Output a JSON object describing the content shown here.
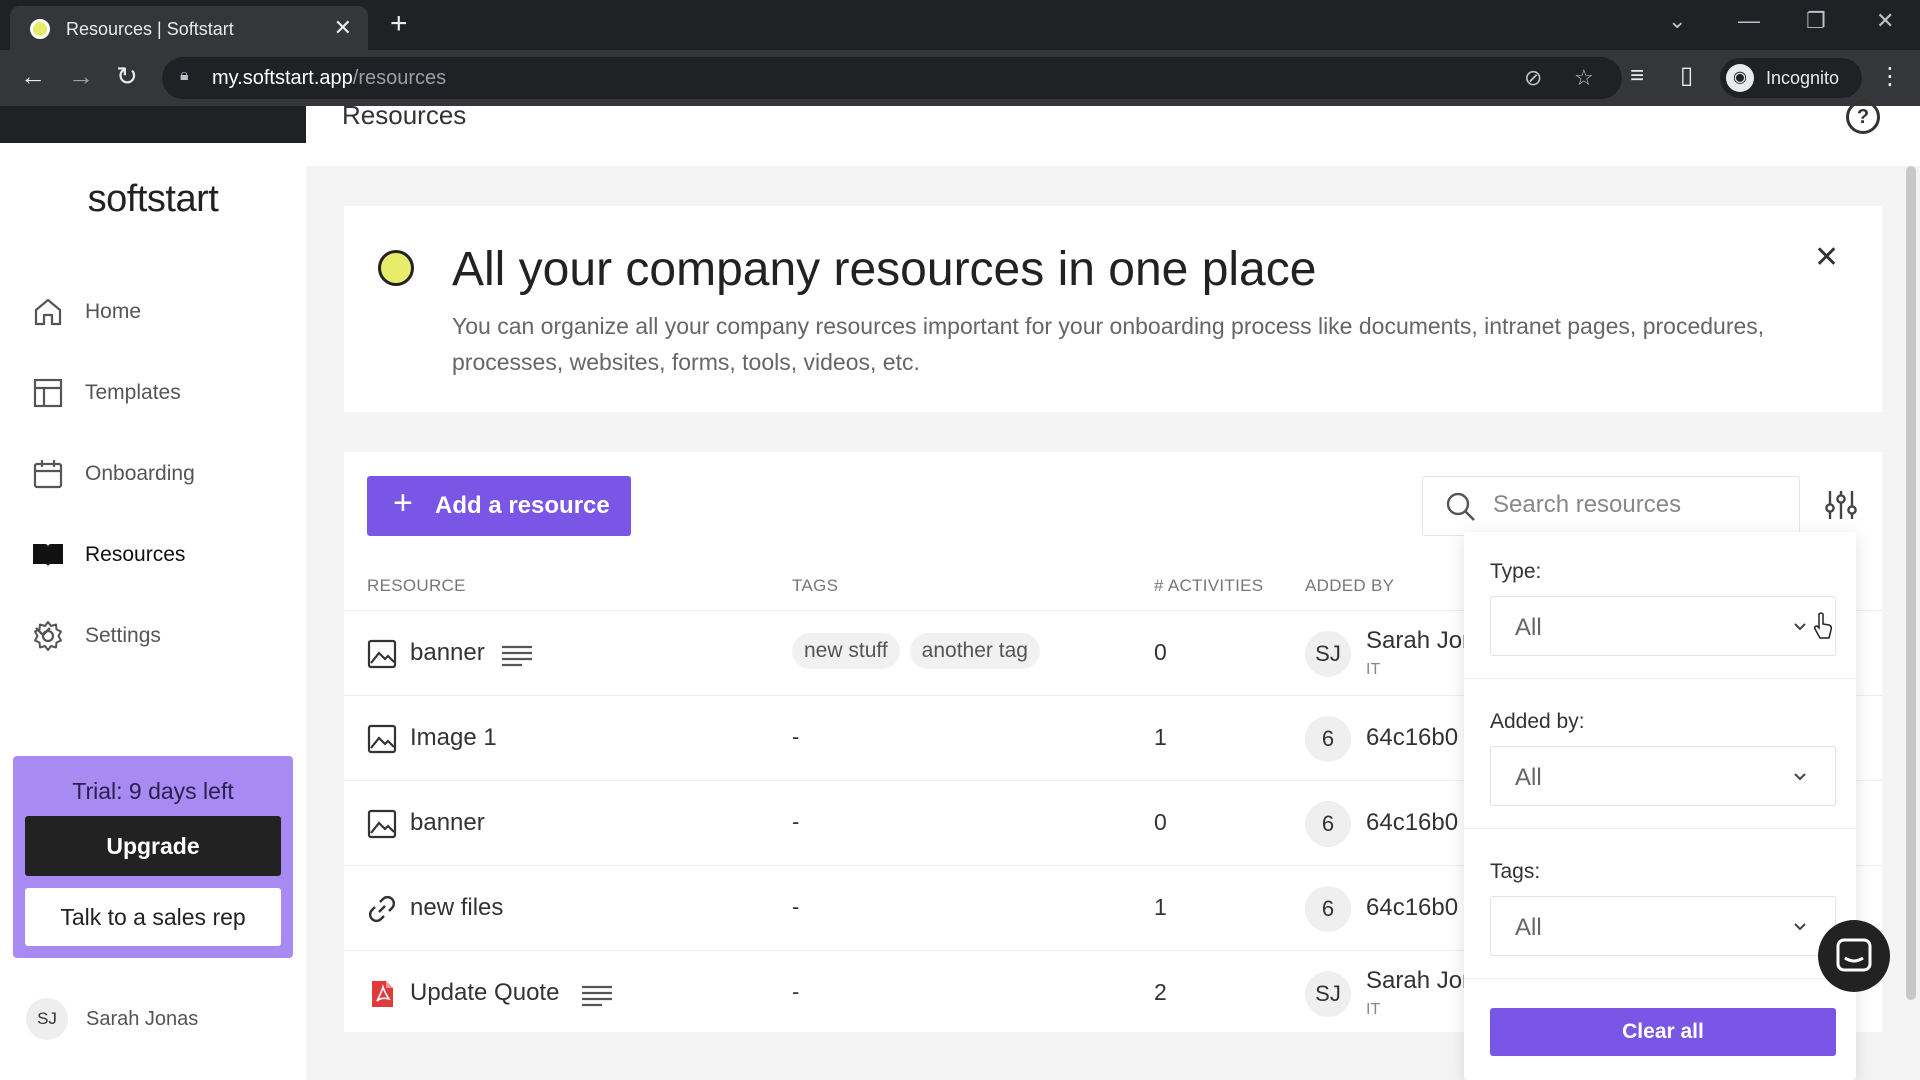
{
  "browser": {
    "tab_title": "Resources | Softstart",
    "url_host": "my.softstart.app",
    "url_path": "/resources",
    "profile_label": "Incognito"
  },
  "sidebar": {
    "logo": "softstart",
    "items": [
      {
        "label": "Home",
        "icon": "home-icon"
      },
      {
        "label": "Templates",
        "icon": "templates-icon"
      },
      {
        "label": "Onboarding",
        "icon": "calendar-icon"
      },
      {
        "label": "Resources",
        "icon": "book-icon",
        "active": true
      },
      {
        "label": "Settings",
        "icon": "gear-icon"
      }
    ],
    "trial_text": "Trial: 9 days left",
    "upgrade_label": "Upgrade",
    "sales_label": "Talk to a sales rep",
    "user_initials": "SJ",
    "user_name": "Sarah Jonas"
  },
  "header": {
    "title": "Resources"
  },
  "banner": {
    "title": "All your company resources in one place",
    "description": "You can organize all your company resources important for your onboarding process like documents, intranet pages, procedures, processes, websites, forms, tools, videos, etc."
  },
  "toolbar": {
    "add_label": "Add a resource",
    "search_placeholder": "Search resources"
  },
  "table": {
    "headers": [
      "RESOURCE",
      "TAGS",
      "# ACTIVITIES",
      "ADDED BY"
    ],
    "rows": [
      {
        "type": "image",
        "name": "banner",
        "has_desc": true,
        "tags": [
          "new stuff",
          "another tag"
        ],
        "activities": "0",
        "avatar": "SJ",
        "added_by": "Sarah Jonas",
        "dept": "IT"
      },
      {
        "type": "image",
        "name": "Image 1",
        "has_desc": false,
        "tags": [],
        "no_tags": "-",
        "activities": "1",
        "avatar": "6",
        "added_by": "64c16b0",
        "dept": ""
      },
      {
        "type": "image",
        "name": "banner",
        "has_desc": false,
        "tags": [],
        "no_tags": "-",
        "activities": "0",
        "avatar": "6",
        "added_by": "64c16b0",
        "dept": ""
      },
      {
        "type": "link",
        "name": "new files",
        "has_desc": false,
        "tags": [],
        "no_tags": "-",
        "activities": "1",
        "avatar": "6",
        "added_by": "64c16b0",
        "dept": ""
      },
      {
        "type": "pdf",
        "name": "Update Quote",
        "has_desc": true,
        "tags": [],
        "no_tags": "-",
        "activities": "2",
        "avatar": "SJ",
        "added_by": "Sarah Jonas",
        "dept": "IT"
      }
    ]
  },
  "filter": {
    "type_label": "Type:",
    "type_value": "All",
    "added_by_label": "Added by:",
    "added_by_value": "All",
    "tags_label": "Tags:",
    "tags_value": "All",
    "clear_label": "Clear all"
  },
  "colors": {
    "accent": "#7a56e6",
    "trial_bg": "#a88bf2",
    "brand_dot": "#e9eb6b"
  }
}
